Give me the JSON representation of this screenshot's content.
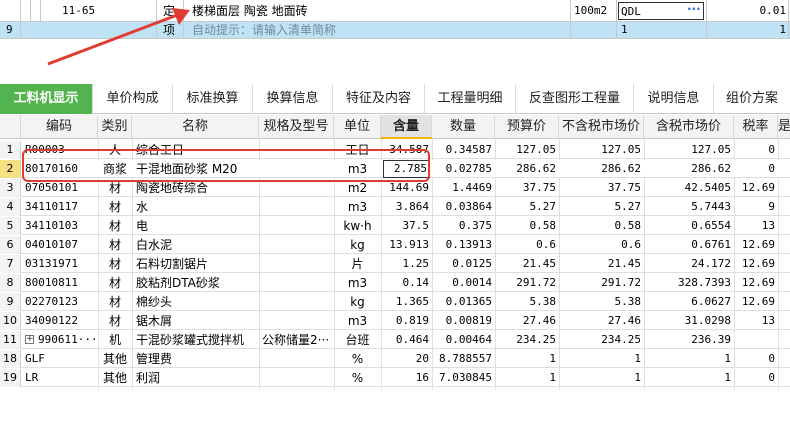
{
  "top_rows": [
    {
      "code": "11-65",
      "type": "定",
      "name": "楼梯面层 陶瓷 地面砖",
      "unit": "100m2",
      "expr": "QDL",
      "qty": "0.01"
    },
    {
      "row": "9",
      "type": "项",
      "hint": "自动提示：请输入清单简称",
      "expr": "1",
      "qty": "1"
    }
  ],
  "tabs": [
    "工料机显示",
    "单价构成",
    "标准换算",
    "换算信息",
    "特征及内容",
    "工程量明细",
    "反查图形工程量",
    "说明信息",
    "组价方案"
  ],
  "columns": [
    "编码",
    "类别",
    "名称",
    "规格及型号",
    "单位",
    "含量",
    "数量",
    "预算价",
    "不含税市场价",
    "含税市场价",
    "税率",
    "是"
  ],
  "rows": [
    {
      "n": "1",
      "code": "R00003",
      "type": "人",
      "name": "综合工日",
      "spec": "",
      "unit": "工日",
      "content": "34.587",
      "qty": "0.34587",
      "budget": "127.05",
      "market": "127.05",
      "tax_market": "127.05",
      "rate": "0"
    },
    {
      "n": "2",
      "code": "80170160",
      "type": "商浆",
      "name": "干混地面砂浆 M20",
      "spec": "",
      "unit": "m3",
      "content": "2.785",
      "qty": "0.02785",
      "budget": "286.62",
      "market": "286.62",
      "tax_market": "286.62",
      "rate": "0"
    },
    {
      "n": "3",
      "code": "07050101",
      "type": "材",
      "name": "陶瓷地砖综合",
      "spec": "",
      "unit": "m2",
      "content": "144.69",
      "qty": "1.4469",
      "budget": "37.75",
      "market": "37.75",
      "tax_market": "42.5405",
      "rate": "12.69"
    },
    {
      "n": "4",
      "code": "34110117",
      "type": "材",
      "name": "水",
      "spec": "",
      "unit": "m3",
      "content": "3.864",
      "qty": "0.03864",
      "budget": "5.27",
      "market": "5.27",
      "tax_market": "5.7443",
      "rate": "9"
    },
    {
      "n": "5",
      "code": "34110103",
      "type": "材",
      "name": "电",
      "spec": "",
      "unit": "kw·h",
      "content": "37.5",
      "qty": "0.375",
      "budget": "0.58",
      "market": "0.58",
      "tax_market": "0.6554",
      "rate": "13"
    },
    {
      "n": "6",
      "code": "04010107",
      "type": "材",
      "name": "白水泥",
      "spec": "",
      "unit": "kg",
      "content": "13.913",
      "qty": "0.13913",
      "budget": "0.6",
      "market": "0.6",
      "tax_market": "0.6761",
      "rate": "12.69"
    },
    {
      "n": "7",
      "code": "03131971",
      "type": "材",
      "name": "石料切割锯片",
      "spec": "",
      "unit": "片",
      "content": "1.25",
      "qty": "0.0125",
      "budget": "21.45",
      "market": "21.45",
      "tax_market": "24.172",
      "rate": "12.69"
    },
    {
      "n": "8",
      "code": "80010811",
      "type": "材",
      "name": "胶粘剂DTA砂浆",
      "spec": "",
      "unit": "m3",
      "content": "0.14",
      "qty": "0.0014",
      "budget": "291.72",
      "market": "291.72",
      "tax_market": "328.7393",
      "rate": "12.69"
    },
    {
      "n": "9",
      "code": "02270123",
      "type": "材",
      "name": "棉纱头",
      "spec": "",
      "unit": "kg",
      "content": "1.365",
      "qty": "0.01365",
      "budget": "5.38",
      "market": "5.38",
      "tax_market": "6.0627",
      "rate": "12.69"
    },
    {
      "n": "10",
      "code": "34090122",
      "type": "材",
      "name": "锯木屑",
      "spec": "",
      "unit": "m3",
      "content": "0.819",
      "qty": "0.00819",
      "budget": "27.46",
      "market": "27.46",
      "tax_market": "31.0298",
      "rate": "13"
    },
    {
      "n": "11",
      "code": "990611···",
      "type": "机",
      "name": "干混砂浆罐式搅拌机",
      "spec": "公称储量2···",
      "unit": "台班",
      "content": "0.464",
      "qty": "0.00464",
      "budget": "234.25",
      "market": "234.25",
      "tax_market": "236.39",
      "rate": ""
    },
    {
      "n": "18",
      "code": "GLF",
      "type": "其他",
      "name": "管理费",
      "spec": "",
      "unit": "%",
      "content": "20",
      "qty": "8.788557",
      "budget": "1",
      "market": "1",
      "tax_market": "1",
      "rate": "0"
    },
    {
      "n": "19",
      "code": "LR",
      "type": "其他",
      "name": "利润",
      "spec": "",
      "unit": "%",
      "content": "16",
      "qty": "7.030845",
      "budget": "1",
      "market": "1",
      "tax_market": "1",
      "rate": "0"
    }
  ]
}
